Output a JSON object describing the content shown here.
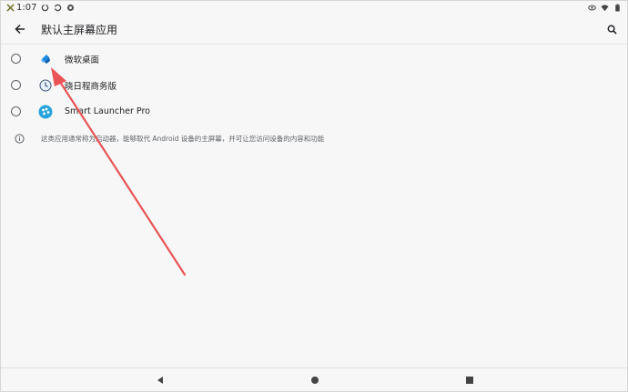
{
  "status_bar": {
    "time": "1:07"
  },
  "app_bar": {
    "title": "默认主屏幕应用",
    "back_icon": "arrow-back-icon",
    "search_icon": "search-icon"
  },
  "apps": [
    {
      "label": "微软桌面",
      "icon": "microsoft-launcher-icon",
      "selected": false
    },
    {
      "label": "晓日程商务版",
      "icon": "schedule-app-icon",
      "selected": false
    },
    {
      "label": "Smart Launcher Pro",
      "icon": "smart-launcher-icon",
      "selected": false
    }
  ],
  "info": {
    "text": "这类应用通常称为启动器，能够取代 Android 设备的主屏幕，并可让您访问设备的内容和功能",
    "icon": "info-icon"
  },
  "nav": {
    "back_icon": "nav-back-icon",
    "home_icon": "nav-home-icon",
    "recents_icon": "nav-recents-icon"
  },
  "colors": {
    "annotation_arrow": "#ea5455",
    "background": "#f7f7f7"
  }
}
